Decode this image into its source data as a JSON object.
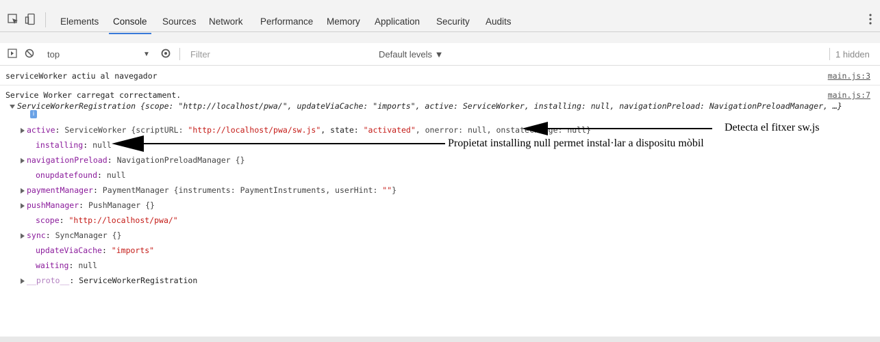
{
  "tabs": [
    "Elements",
    "Console",
    "Sources",
    "Network",
    "Performance",
    "Memory",
    "Application",
    "Security",
    "Audits"
  ],
  "active_tab": "Console",
  "filter_row": {
    "context": "top",
    "filter_placeholder": "Filter",
    "levels": "Default levels ▼",
    "hidden": "1 hidden"
  },
  "messages": {
    "m1_text": "serviceWorker actiu al navegador",
    "m1_src": "main.js:3",
    "m2_text": "Service Worker carregat correctament.",
    "m2_src": "main.js:7",
    "reg_summary": "ServiceWorkerRegistration {scope: \"http://localhost/pwa/\", updateViaCache: \"imports\", active: ServiceWorker, installing: null, navigationPreload: NavigationPreloadManager, …}"
  },
  "props": {
    "active_key": "active",
    "active_val_type": "ServiceWorker {scriptURL: ",
    "active_url": "\"http://localhost/pwa/sw.js\"",
    "active_mid": ", state: ",
    "active_state": "\"activated\"",
    "active_rest": ", onerror: null, onstatechange: null}",
    "installing_key": "installing",
    "installing_val": "null",
    "navpreload_key": "navigationPreload",
    "navpreload_val": "NavigationPreloadManager {}",
    "onupdatefound_key": "onupdatefound",
    "onupdatefound_val": "null",
    "payment_key": "paymentManager",
    "payment_val": "PaymentManager {instruments: PaymentInstruments, userHint: ",
    "payment_hint": "\"\"",
    "payment_close": "}",
    "push_key": "pushManager",
    "push_val": "PushManager {}",
    "scope_key": "scope",
    "scope_val": "\"http://localhost/pwa/\"",
    "sync_key": "sync",
    "sync_val": "SyncManager {}",
    "uvc_key": "updateViaCache",
    "uvc_val": "\"imports\"",
    "waiting_key": "waiting",
    "waiting_val": "null",
    "proto_key": "__proto__",
    "proto_val": "ServiceWorkerRegistration"
  },
  "annotations": {
    "sw": "Detecta el fitxer sw.js",
    "installing": "Propietat installing null permet instal·lar a dispositu mòbil"
  },
  "colors": {
    "accent": "#3879d9",
    "key": "#8a1a9b",
    "string": "#c41a16"
  }
}
